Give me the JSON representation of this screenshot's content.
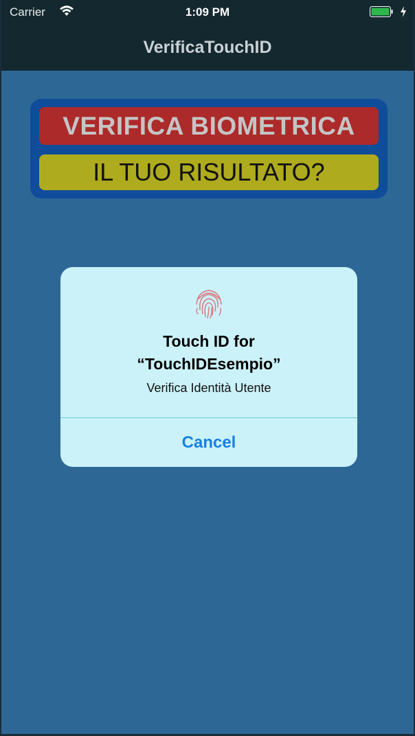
{
  "status_bar": {
    "carrier": "Carrier",
    "time": "1:09 PM",
    "battery_color": "#2fb74d"
  },
  "nav": {
    "title": "VerificaTouchID"
  },
  "banner": {
    "title": "VERIFICA BIOMETRICA",
    "subtitle": "IL TUO RISULTATO?",
    "colors": {
      "frame": "#0f4c9a",
      "title_bg": "#ad2a2a",
      "subtitle_bg": "#aeab1e"
    }
  },
  "alert": {
    "icon": "fingerprint-icon",
    "title_line1": "Touch ID for",
    "title_line2": "“TouchIDEsempio”",
    "message": "Verifica Identità Utente",
    "cancel_label": "Cancel"
  },
  "colors": {
    "background": "#2d6796",
    "nav_bar": "#14282f",
    "alert_bg": "#cbf2f8",
    "accent": "#1a7fe0"
  }
}
